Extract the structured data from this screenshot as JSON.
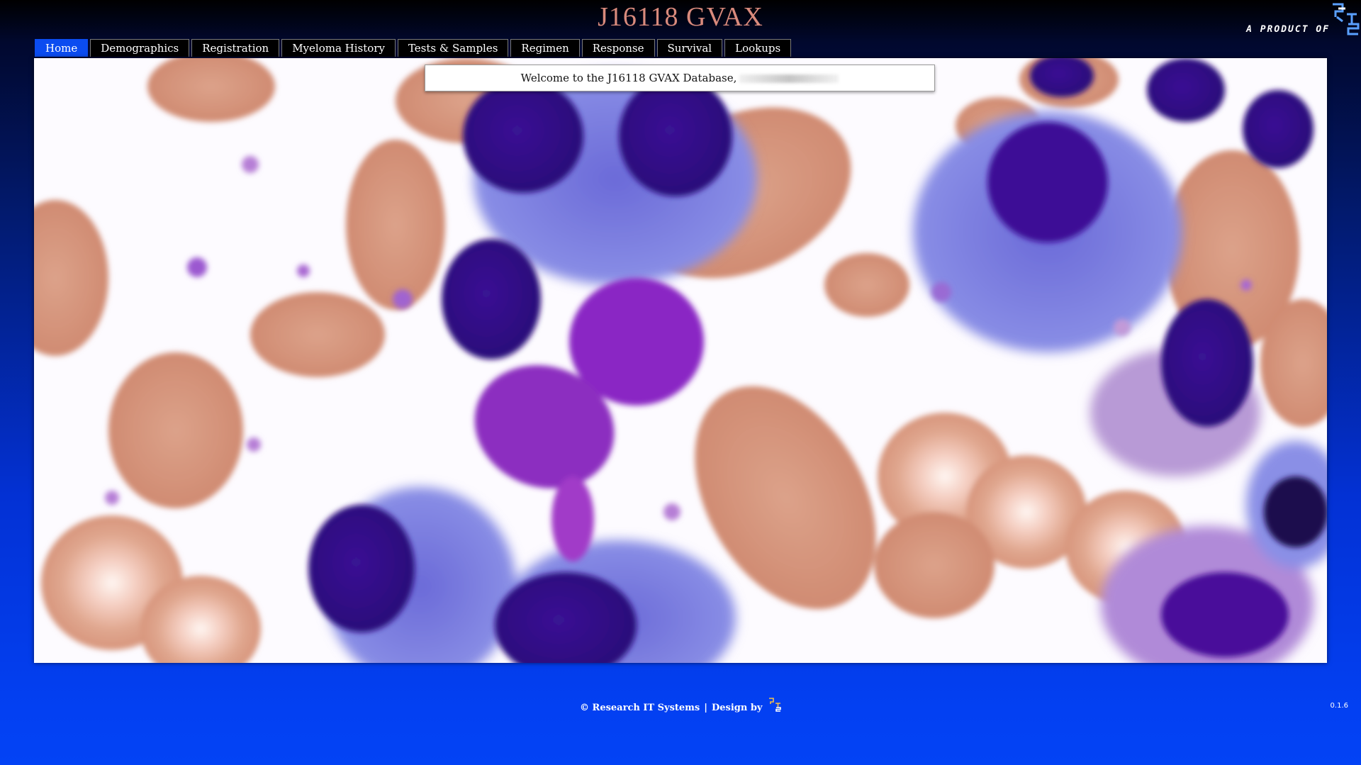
{
  "header": {
    "title": "J16118 GVAX",
    "brand_text": "A PRODUCT OF"
  },
  "nav": {
    "tabs": [
      {
        "label": "Home",
        "active": true
      },
      {
        "label": "Demographics",
        "active": false
      },
      {
        "label": "Registration",
        "active": false
      },
      {
        "label": "Myeloma History",
        "active": false
      },
      {
        "label": "Tests & Samples",
        "active": false
      },
      {
        "label": "Regimen",
        "active": false
      },
      {
        "label": "Response",
        "active": false
      },
      {
        "label": "Survival",
        "active": false
      },
      {
        "label": "Lookups",
        "active": false
      }
    ]
  },
  "main": {
    "welcome_text": "Welcome to the J16118 GVAX Database,"
  },
  "footer": {
    "copyright": "© Research IT Systems",
    "separator": "|",
    "design_by": "Design by",
    "version": "0.1.6"
  },
  "colors": {
    "title": "#d98a7c",
    "active_tab": "#0b4cf0",
    "tab_bg": "#000000",
    "page_bottom": "#0343f5"
  },
  "icons": {
    "brand_logo": "rits-logo-icon",
    "footer_logo": "rits-small-logo-icon"
  }
}
